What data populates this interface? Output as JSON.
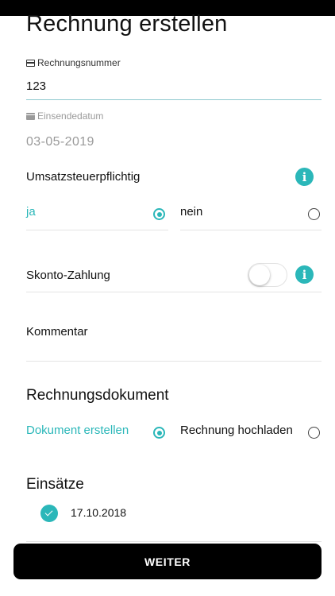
{
  "page": {
    "title": "Rechnung erstellen"
  },
  "invoice_number": {
    "label": "Rechnungsnummer",
    "value": "123",
    "icon": "credit-card-icon"
  },
  "submit_date": {
    "label": "Einsendedatum",
    "value": "03-05-2019",
    "icon": "calendar-icon"
  },
  "vat": {
    "label": "Umsatzsteuerpflichtig",
    "info_icon": "info-icon",
    "options": [
      {
        "label": "ja",
        "selected": true
      },
      {
        "label": "nein",
        "selected": false
      }
    ]
  },
  "skonto": {
    "label": "Skonto-Zahlung",
    "enabled": false,
    "info_icon": "info-icon"
  },
  "comment": {
    "label": "Kommentar"
  },
  "document": {
    "title": "Rechnungsdokument",
    "options": [
      {
        "label": "Dokument erstellen",
        "selected": true
      },
      {
        "label": "Rechnung hochladen",
        "selected": false
      }
    ]
  },
  "assignments": {
    "title": "Einsätze",
    "items": [
      {
        "date": "17.10.2018",
        "checked": true
      }
    ]
  },
  "button": {
    "label": "WEITER"
  },
  "colors": {
    "accent": "#2bb7b9",
    "button_bg": "#000000",
    "text": "#111111",
    "muted": "#9a9a9a"
  }
}
